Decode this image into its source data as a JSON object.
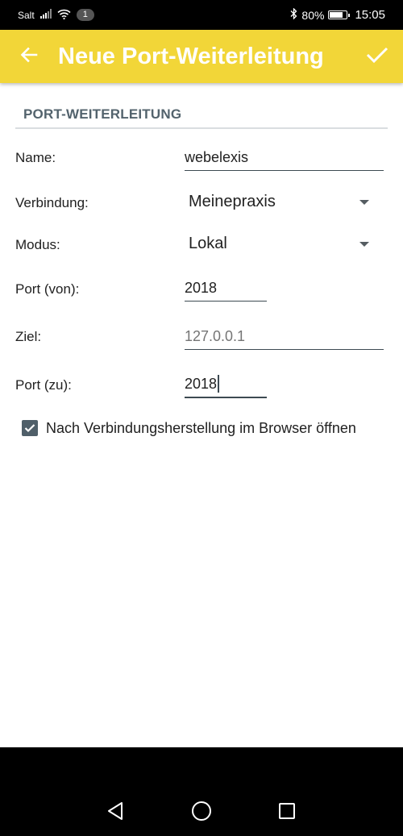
{
  "status_bar": {
    "carrier": "Salt",
    "notification_count": "1",
    "battery_percent": "80%",
    "battery_level": 0.8,
    "time": "15:05"
  },
  "app_bar": {
    "title": "Neue Port-Weiterleitung",
    "background_color": "#f2d638",
    "back_icon": "arrow-left-icon",
    "confirm_icon": "checkmark-icon"
  },
  "section": {
    "title": "PORT-WEITERLEITUNG"
  },
  "form": {
    "name_label": "Name:",
    "name_value": "webelexis",
    "connection_label": "Verbindung:",
    "connection_value": "Meinepraxis",
    "mode_label": "Modus:",
    "mode_value": "Lokal",
    "port_from_label": "Port (von):",
    "port_from_value": "2018",
    "target_label": "Ziel:",
    "target_placeholder": "127.0.0.1",
    "port_to_label": "Port (zu):",
    "port_to_value": "2018",
    "open_browser_checked": true,
    "open_browser_label": "Nach Verbindungsherstellung im Browser öffnen"
  },
  "nav_bar": {
    "back_icon": "nav-back-triangle-icon",
    "home_icon": "nav-home-circle-icon",
    "recents_icon": "nav-recents-square-icon"
  }
}
